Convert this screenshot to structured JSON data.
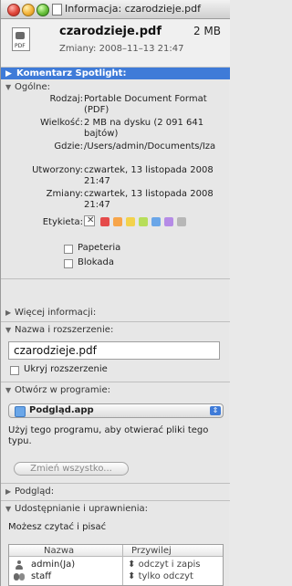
{
  "window": {
    "title": "Informacja: czarodzieje.pdf"
  },
  "header": {
    "file_name": "czarodzieje.pdf",
    "file_size": "2 MB",
    "modified_line": "Zmiany: 2008–11–13 21:47",
    "file_icon_label": "PDF"
  },
  "sections": {
    "spotlight": "Komentarz Spotlight:",
    "general": "Ogólne:",
    "more_info": "Więcej informacji:",
    "name_ext": "Nazwa i rozszerzenie:",
    "open_with": "Otwórz w programie:",
    "preview": "Podgląd:",
    "sharing": "Udostępnianie i uprawnienia:"
  },
  "general": {
    "kind_label": "Rodzaj:",
    "kind_value": "Portable Document Format (PDF)",
    "size_label": "Wielkość:",
    "size_value": "2 MB na dysku (2 091 641 bajtów)",
    "where_label": "Gdzie:",
    "where_value": "/Users/admin/Documents/Iza",
    "created_label": "Utworzony:",
    "created_value": "czwartek, 13 listopada 2008 21:47",
    "modified_label": "Zmiany:",
    "modified_value": "czwartek, 13 listopada 2008 21:47",
    "label_label": "Etykieta:",
    "label_none": "✕",
    "label_colors": [
      "#e54b4b",
      "#f7a54a",
      "#f3d24c",
      "#b7de5a",
      "#6aa6e8",
      "#b58be6",
      "#b7b7b7"
    ],
    "stationery": "Papeteria",
    "locked": "Blokada"
  },
  "name_ext": {
    "value": "czarodzieje.pdf",
    "hide_extension": "Ukryj rozszerzenie"
  },
  "open_with": {
    "app": "Podgląd.app",
    "description": "Użyj tego programu, aby otwierać pliki tego typu.",
    "change_all": "Zmień wszystko..."
  },
  "sharing": {
    "summary": "Możesz czytać i pisać",
    "col_name": "Nazwa",
    "col_privilege": "Przywilej",
    "rows": [
      {
        "name": "admin(Ja)",
        "privilege": "odczyt i zapis"
      },
      {
        "name": "staff",
        "privilege": "tylko odczyt"
      }
    ]
  },
  "icons": {
    "disclosure_open": "▼",
    "disclosure_closed": "▶",
    "popup_arrows": "⇕",
    "updown": "⬍"
  }
}
